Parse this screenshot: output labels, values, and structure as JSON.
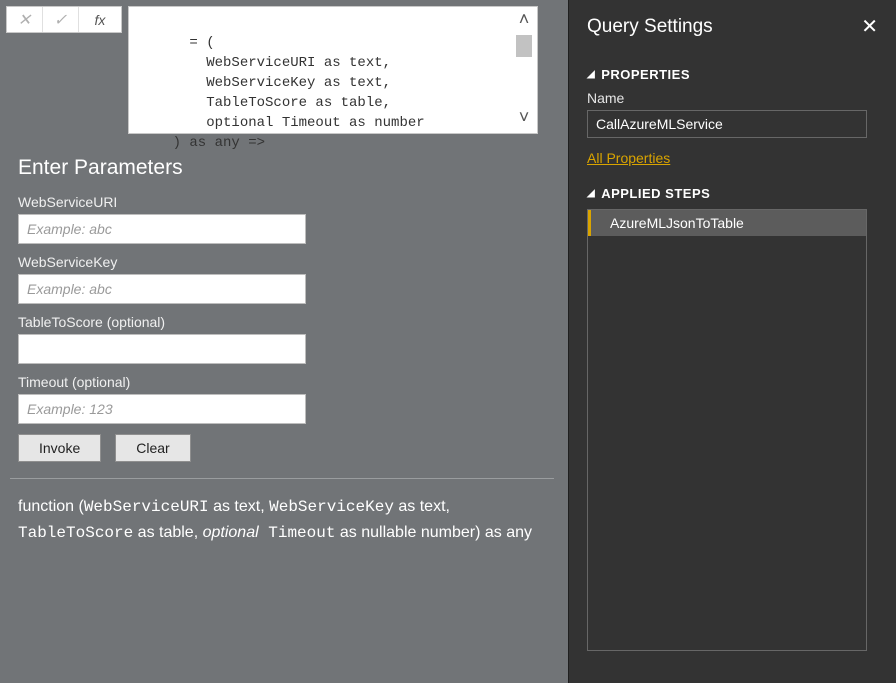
{
  "formula_bar": {
    "cancel_glyph": "✕",
    "confirm_glyph": "✓",
    "fx_label": "fx",
    "code": "= (\n        WebServiceURI as text,\n        WebServiceKey as text,\n        TableToScore as table,\n        optional Timeout as number\n    ) as any =>"
  },
  "params": {
    "title": "Enter Parameters",
    "fields": [
      {
        "label": "WebServiceURI",
        "placeholder": "Example: abc",
        "value": ""
      },
      {
        "label": "WebServiceKey",
        "placeholder": "Example: abc",
        "value": ""
      },
      {
        "label": "TableToScore (optional)",
        "placeholder": "",
        "value": ""
      },
      {
        "label": "Timeout (optional)",
        "placeholder": "Example: 123",
        "value": ""
      }
    ],
    "invoke_label": "Invoke",
    "clear_label": "Clear"
  },
  "signature": {
    "prefix": "function (",
    "p1": "WebServiceURI",
    "t1": " as text, ",
    "p2": "WebServiceKey",
    "t2": " as text, ",
    "p3": "TableToScore",
    "t3": " as table, ",
    "opt": "optional",
    "p4": " Timeout",
    "t4": " as nullable number) as any"
  },
  "query_settings": {
    "title": "Query Settings",
    "properties_header": "PROPERTIES",
    "name_label": "Name",
    "name_value": "CallAzureMLService",
    "all_properties": "All Properties",
    "applied_steps_header": "APPLIED STEPS",
    "steps": [
      {
        "label": "AzureMLJsonToTable"
      }
    ]
  }
}
